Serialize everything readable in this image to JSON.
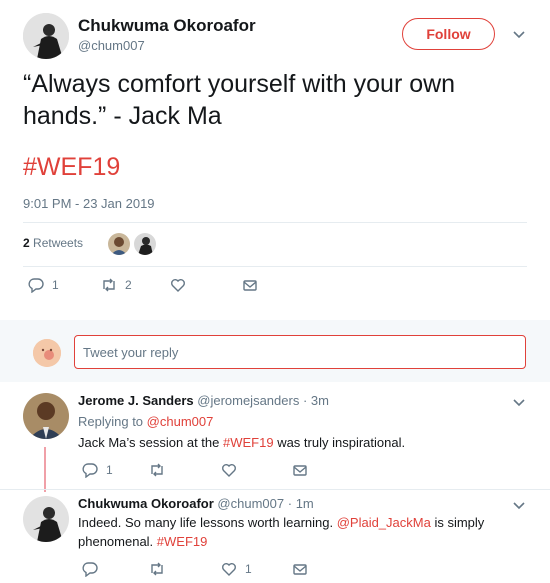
{
  "main_tweet": {
    "name": "Chukwuma Okoroafor",
    "handle": "@chum007",
    "follow_label": "Follow",
    "text": "“Always comfort yourself with your own hands.” - Jack Ma",
    "hashtag": "#WEF19",
    "timestamp": "9:01 PM - 23 Jan 2019",
    "retweet_count": "2",
    "retweet_label": " Retweets",
    "actions": {
      "reply_count": "1",
      "retweet_count": "2"
    }
  },
  "reply_box": {
    "placeholder": "Tweet your reply"
  },
  "replies": [
    {
      "name": "Jerome J. Sanders",
      "handle": "@jeromejsanders",
      "time": "3m",
      "replying_prefix": "Replying to ",
      "replying_to": "@chum007",
      "text_before": "Jack Ma’s session at the ",
      "hashtag": "#WEF19",
      "text_after": " was truly inspirational.",
      "reply_count": "1"
    },
    {
      "name": "Chukwuma Okoroafor",
      "handle": "@chum007",
      "time": "1m",
      "text_before": "Indeed. So many life lessons worth learning. ",
      "mention": "@Plaid_JackMa",
      "text_after": "  is simply",
      "line2_hashtag": "#WEF19",
      "line2_prefix": "phenomenal. ",
      "like_count": "1"
    }
  ],
  "colors": {
    "accent": "#e0413a",
    "secondary_text": "#657786",
    "reply_bg": "#f5f8fa"
  },
  "icons": [
    "chevron-down-icon",
    "reply-icon",
    "retweet-icon",
    "heart-icon",
    "dm-icon"
  ]
}
